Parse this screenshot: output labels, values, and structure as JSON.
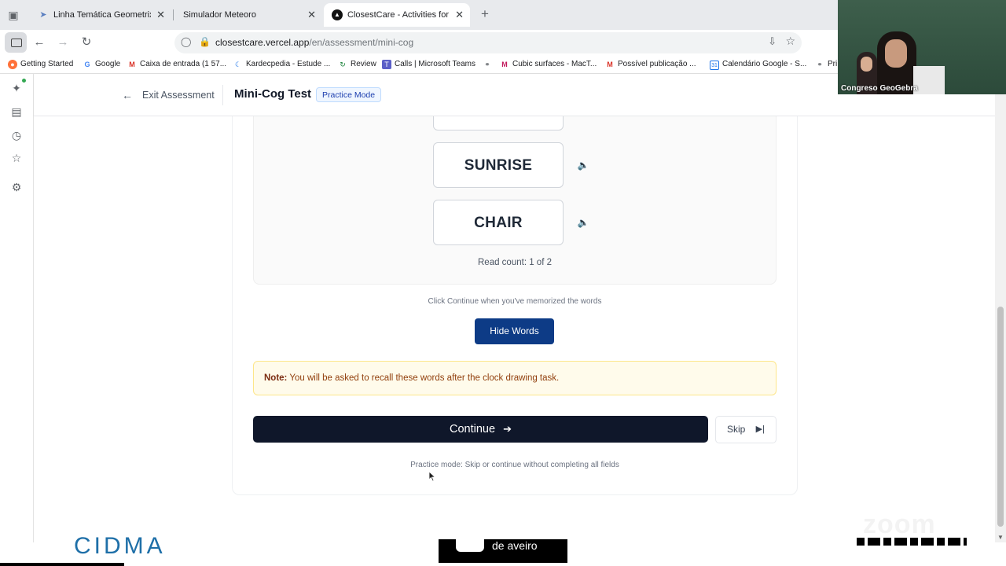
{
  "browser": {
    "tabs": [
      {
        "label": "Linha Temática Geometrix",
        "icon": "geogebra-tab-icon"
      },
      {
        "label": "Simulador Meteoro",
        "icon": "page-icon"
      },
      {
        "label": "ClosestCare - Activities for Elde",
        "icon": "closestcare-tab-icon",
        "active": true
      }
    ],
    "url_host": "closestcare.vercel.app",
    "url_path": "/en/assessment/mini-cog",
    "bookmarks": [
      "Getting Started",
      "Google",
      "Caixa de entrada (1 57...",
      "Kardecpedia - Estude ...",
      "Review",
      "Calls | Microsoft Teams",
      "",
      "Cubic surfaces - MacT...",
      "Possível publicação ...",
      "Calendário Google - S...",
      "Pri"
    ]
  },
  "header": {
    "exit_label": "Exit Assessment",
    "title": "Mini-Cog Test",
    "badge": "Practice Mode"
  },
  "words": [
    "SUNRISE",
    "CHAIR"
  ],
  "read_count": "Read count: 1 of 2",
  "memorize_hint": "Click Continue when you've memorized the words",
  "hide_button": "Hide Words",
  "note": {
    "label": "Note:",
    "text": "You will be asked to recall these words after the clock drawing task."
  },
  "continue_button": "Continue",
  "skip_button": "Skip",
  "practice_note": "Practice mode: Skip or continue without completing all fields",
  "video": {
    "label": "Congreso GeoGebra"
  },
  "footer": {
    "left_logo": "CIDMA",
    "center_logo": "de aveiro",
    "watermark": "zoom"
  },
  "colors": {
    "primary_button": "#0f172a",
    "hide_button": "#0d3b86",
    "note_bg": "#fffbeb",
    "badge_text": "#1e40af"
  }
}
